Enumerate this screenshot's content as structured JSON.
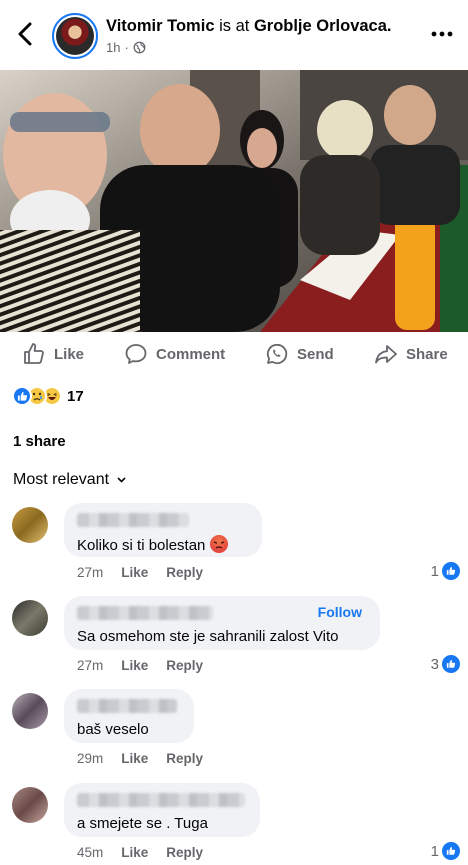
{
  "header": {
    "author": "Vitomir Tomic",
    "is_at": " is at ",
    "place": "Groblje Orlovaca.",
    "time": "1h",
    "privacy_icon": "globe-icon",
    "back_icon": "chevron-left-icon",
    "more_icon": "more-horizontal-icon"
  },
  "actions": {
    "like": "Like",
    "comment": "Comment",
    "send": "Send",
    "share": "Share"
  },
  "reactions": {
    "icons": [
      "like-reaction-icon",
      "sad-reaction-icon",
      "haha-reaction-icon"
    ],
    "count": "17"
  },
  "shares": "1 share",
  "sort": {
    "label": "Most relevant",
    "icon": "chevron-down-icon"
  },
  "comments": [
    {
      "text": "Koliko si ti bolestan",
      "emoji": "angry-emoji-icon",
      "time": "27m",
      "like": "Like",
      "reply": "Reply",
      "likes": "1",
      "follow": ""
    },
    {
      "text": "Sa osmehom ste je sahranili zalost Vito",
      "time": "27m",
      "like": "Like",
      "reply": "Reply",
      "likes": "3",
      "follow": "Follow"
    },
    {
      "text": "baš veselo",
      "time": "29m",
      "like": "Like",
      "reply": "Reply",
      "likes": "",
      "follow": ""
    },
    {
      "text": "a smejete se . Tuga",
      "time": "45m",
      "like": "Like",
      "reply": "Reply",
      "likes": "1",
      "follow": ""
    }
  ],
  "colors": {
    "accent": "#1877f2",
    "secondary_text": "#65676b",
    "bubble": "#f0f2f5"
  }
}
